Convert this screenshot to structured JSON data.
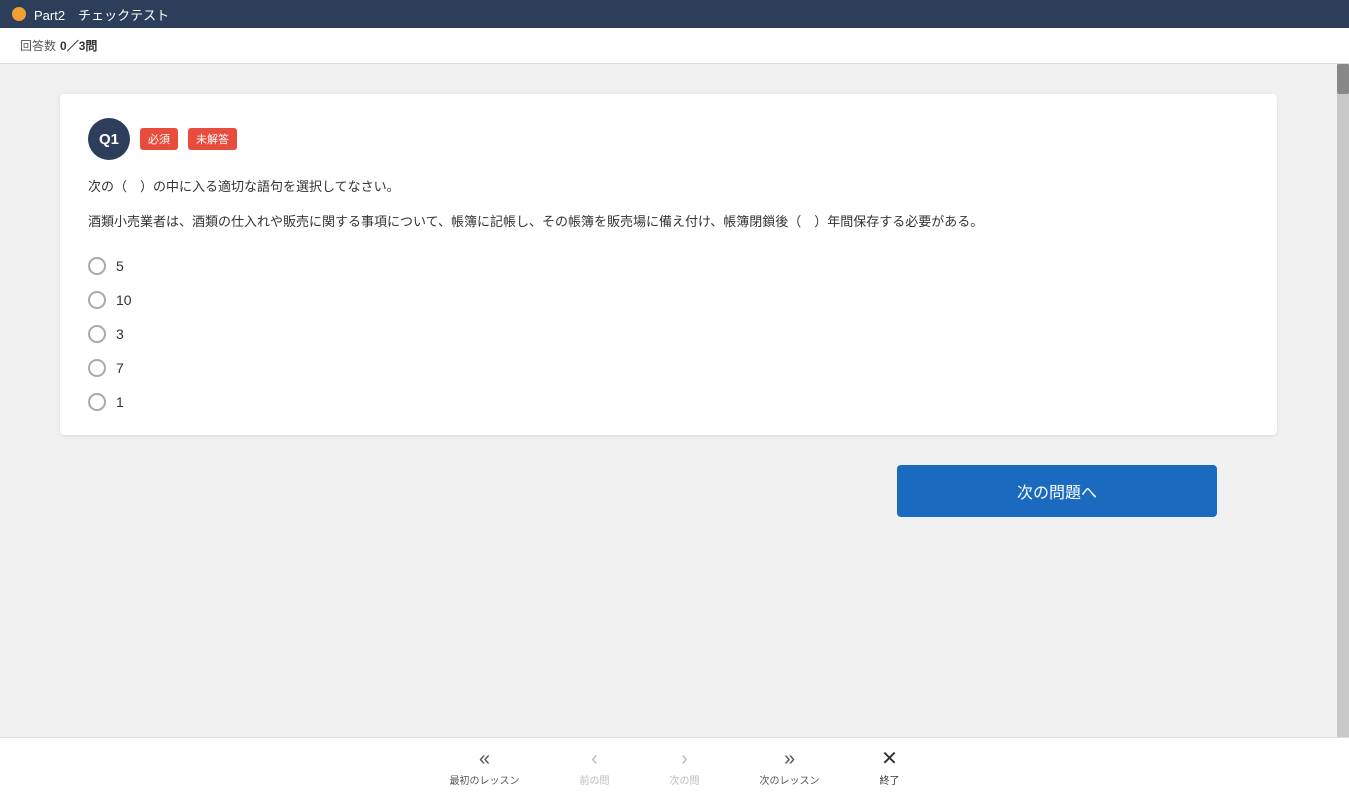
{
  "header": {
    "dot_color": "#f0a030",
    "title": "Part2　チェックテスト"
  },
  "progress": {
    "label": "回答数",
    "count": "0／3問"
  },
  "question": {
    "id": "Q1",
    "tag_required": "必須",
    "tag_unanswered": "未解答",
    "instruction": "次の（　）の中に入る適切な語句を選択してなさい。",
    "text": "酒類小売業者は、酒類の仕入れや販売に関する事項について、帳簿に記帳し、その帳簿を販売場に備え付け、帳簿閉鎖後（　）年間保存する必要がある。",
    "options": [
      {
        "value": "5",
        "label": "5"
      },
      {
        "value": "10",
        "label": "10"
      },
      {
        "value": "3",
        "label": "3"
      },
      {
        "value": "7",
        "label": "7"
      },
      {
        "value": "1",
        "label": "1"
      }
    ]
  },
  "next_button_label": "次の問題へ",
  "bottom_nav": {
    "first_lesson_label": "最初のレッスン",
    "prev_label": "前の問",
    "next_label": "次の問",
    "last_lesson_label": "次のレッスン",
    "close_label": "終了"
  }
}
